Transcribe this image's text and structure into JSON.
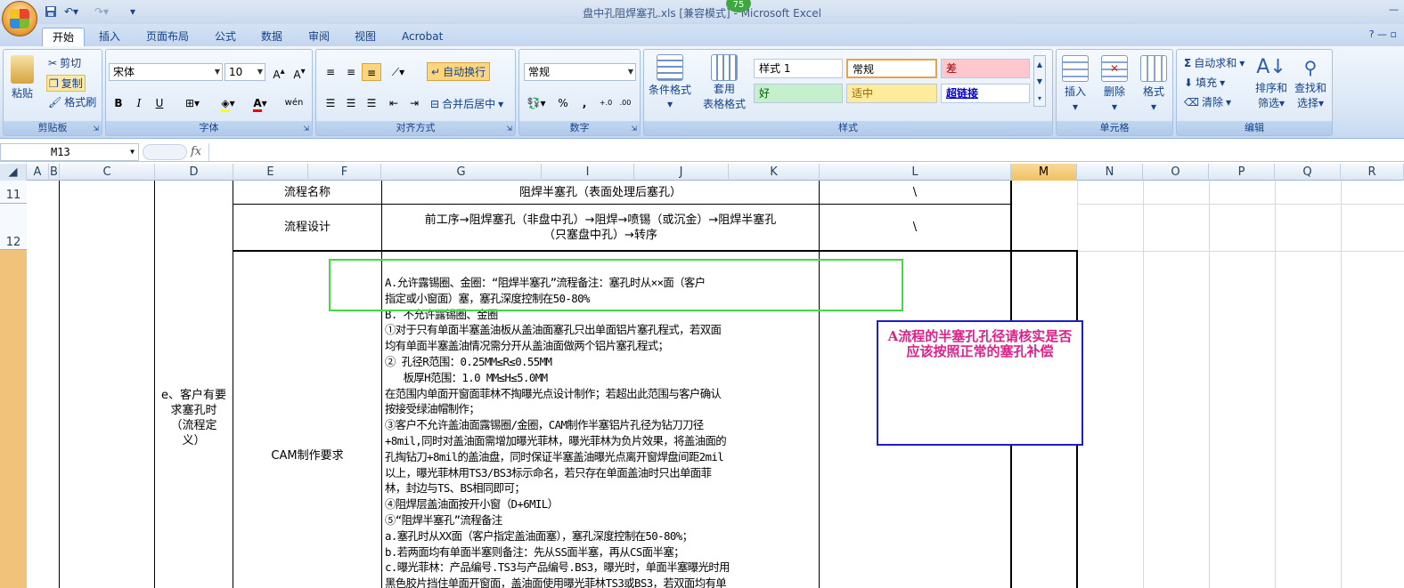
{
  "window": {
    "title": "盘中孔阻焊塞孔.xls  [兼容模式] - Microsoft Excel",
    "badge": "75"
  },
  "tabs": [
    "开始",
    "插入",
    "页面布局",
    "公式",
    "数据",
    "审阅",
    "视图",
    "Acrobat"
  ],
  "ribbon": {
    "clipboard": {
      "paste": "粘贴",
      "cut": "剪切",
      "copy": "复制",
      "format_painter": "格式刷",
      "label": "剪贴板"
    },
    "font": {
      "name": "宋体",
      "size": "10",
      "bold": "B",
      "italic": "I",
      "underline": "U",
      "phonetic": "wén",
      "label": "字体"
    },
    "alignment": {
      "wrap": "自动换行",
      "merge": "合并后居中",
      "label": "对齐方式"
    },
    "number": {
      "format": "常规",
      "percent": "%",
      "comma": ",",
      "inc": "+.0",
      "dec": ".00",
      "label": "数字"
    },
    "styles": {
      "conditional": "条件格式",
      "table_a": "套用",
      "table_b": "表格格式",
      "cells": [
        "样式 1",
        "常规",
        "差",
        "好",
        "适中",
        "超链接"
      ],
      "label": "样式"
    },
    "cells": {
      "insert": "插入",
      "delete": "删除",
      "format": "格式",
      "label": "单元格"
    },
    "editing": {
      "autosum": "自动求和",
      "fill": "填充",
      "clear": "清除",
      "sort_a": "排序和",
      "sort_b": "筛选",
      "find_a": "查找和",
      "find_b": "选择",
      "label": "编辑"
    }
  },
  "formula_bar": {
    "name_box": "M13",
    "fx": "fx",
    "value": ""
  },
  "columns": [
    "A",
    "B",
    "C",
    "D",
    "E",
    "F",
    "G",
    "I",
    "J",
    "K",
    "L",
    "M",
    "N",
    "O",
    "P",
    "Q",
    "R"
  ],
  "selected_column": "M",
  "rows": [
    "11",
    "12"
  ],
  "sheet": {
    "r11_label": "流程名称",
    "r11_value": "阻焊半塞孔（表面处理后塞孔）",
    "r11_L": "\\",
    "r12_label": "流程设计",
    "r12_value": "前工序→阻焊塞孔（非盘中孔）→阻焊→喷锡（或沉金）→阻焊半塞孔\n（只塞盘中孔）→转序",
    "r12_L": "\\",
    "d_label": "e、客户有要\n求塞孔时\n（流程定\n义）",
    "e_label": "CAM制作要求",
    "note": "A.允许露锡圈、金圈：“阻焊半塞孔”流程备注：塞孔时从××面（客户\n指定或小窗面）塞，塞孔深度控制在50-80%\nB. 不允许露锡圈、金圈\n①对于只有单面半塞盖油板从盖油面塞孔只出单面铝片塞孔程式，若双面\n均有单面半塞盖油情况需分开从盖油面做两个铝片塞孔程式；\n② 孔径R范围：0.25MM≤R≤0.55MM\n   板厚H范围：1.0 MM≤H≤5.0MM\n在范围内单面开窗面菲林不掏曝光点设计制作；若超出此范围与客户确认\n按接受绿油帽制作；\n③客户不允许盖油面露锡圈/金圈，CAM制作半塞铝片孔径为钻刀刀径\n+8mil,同时对盖油面需增加曝光菲林，曝光菲林为负片效果，将盖油面的\n孔掏钻刀+8mil的盖油盘，同时保证半塞盖油曝光点离开窗焊盘间距2mil\n以上，曝光菲林用TS3/BS3标示命名，若只存在单面盖油时只出单面菲\n林，封边与TS、BS相同即可；\n④阻焊层盖油面按开小窗（D+6MIL）\n⑤“阻焊半塞孔”流程备注\na.塞孔时从XX面（客户指定盖油面塞），塞孔深度控制在50-80%；\nb.若两面均有单面半塞则备注：先从SS面半塞，再从CS面半塞；\nc.曝光菲林：产品编号.TS3与产品编号.BS3，曝光时，单面半塞曝光时用\n黑色胶片挡住单面开窗面，盖油面使用曝光菲林TS3或BS3，若双面均有单",
    "comment": "A流程的半塞孔孔径请核实是否应该按照正常的塞孔补偿"
  }
}
